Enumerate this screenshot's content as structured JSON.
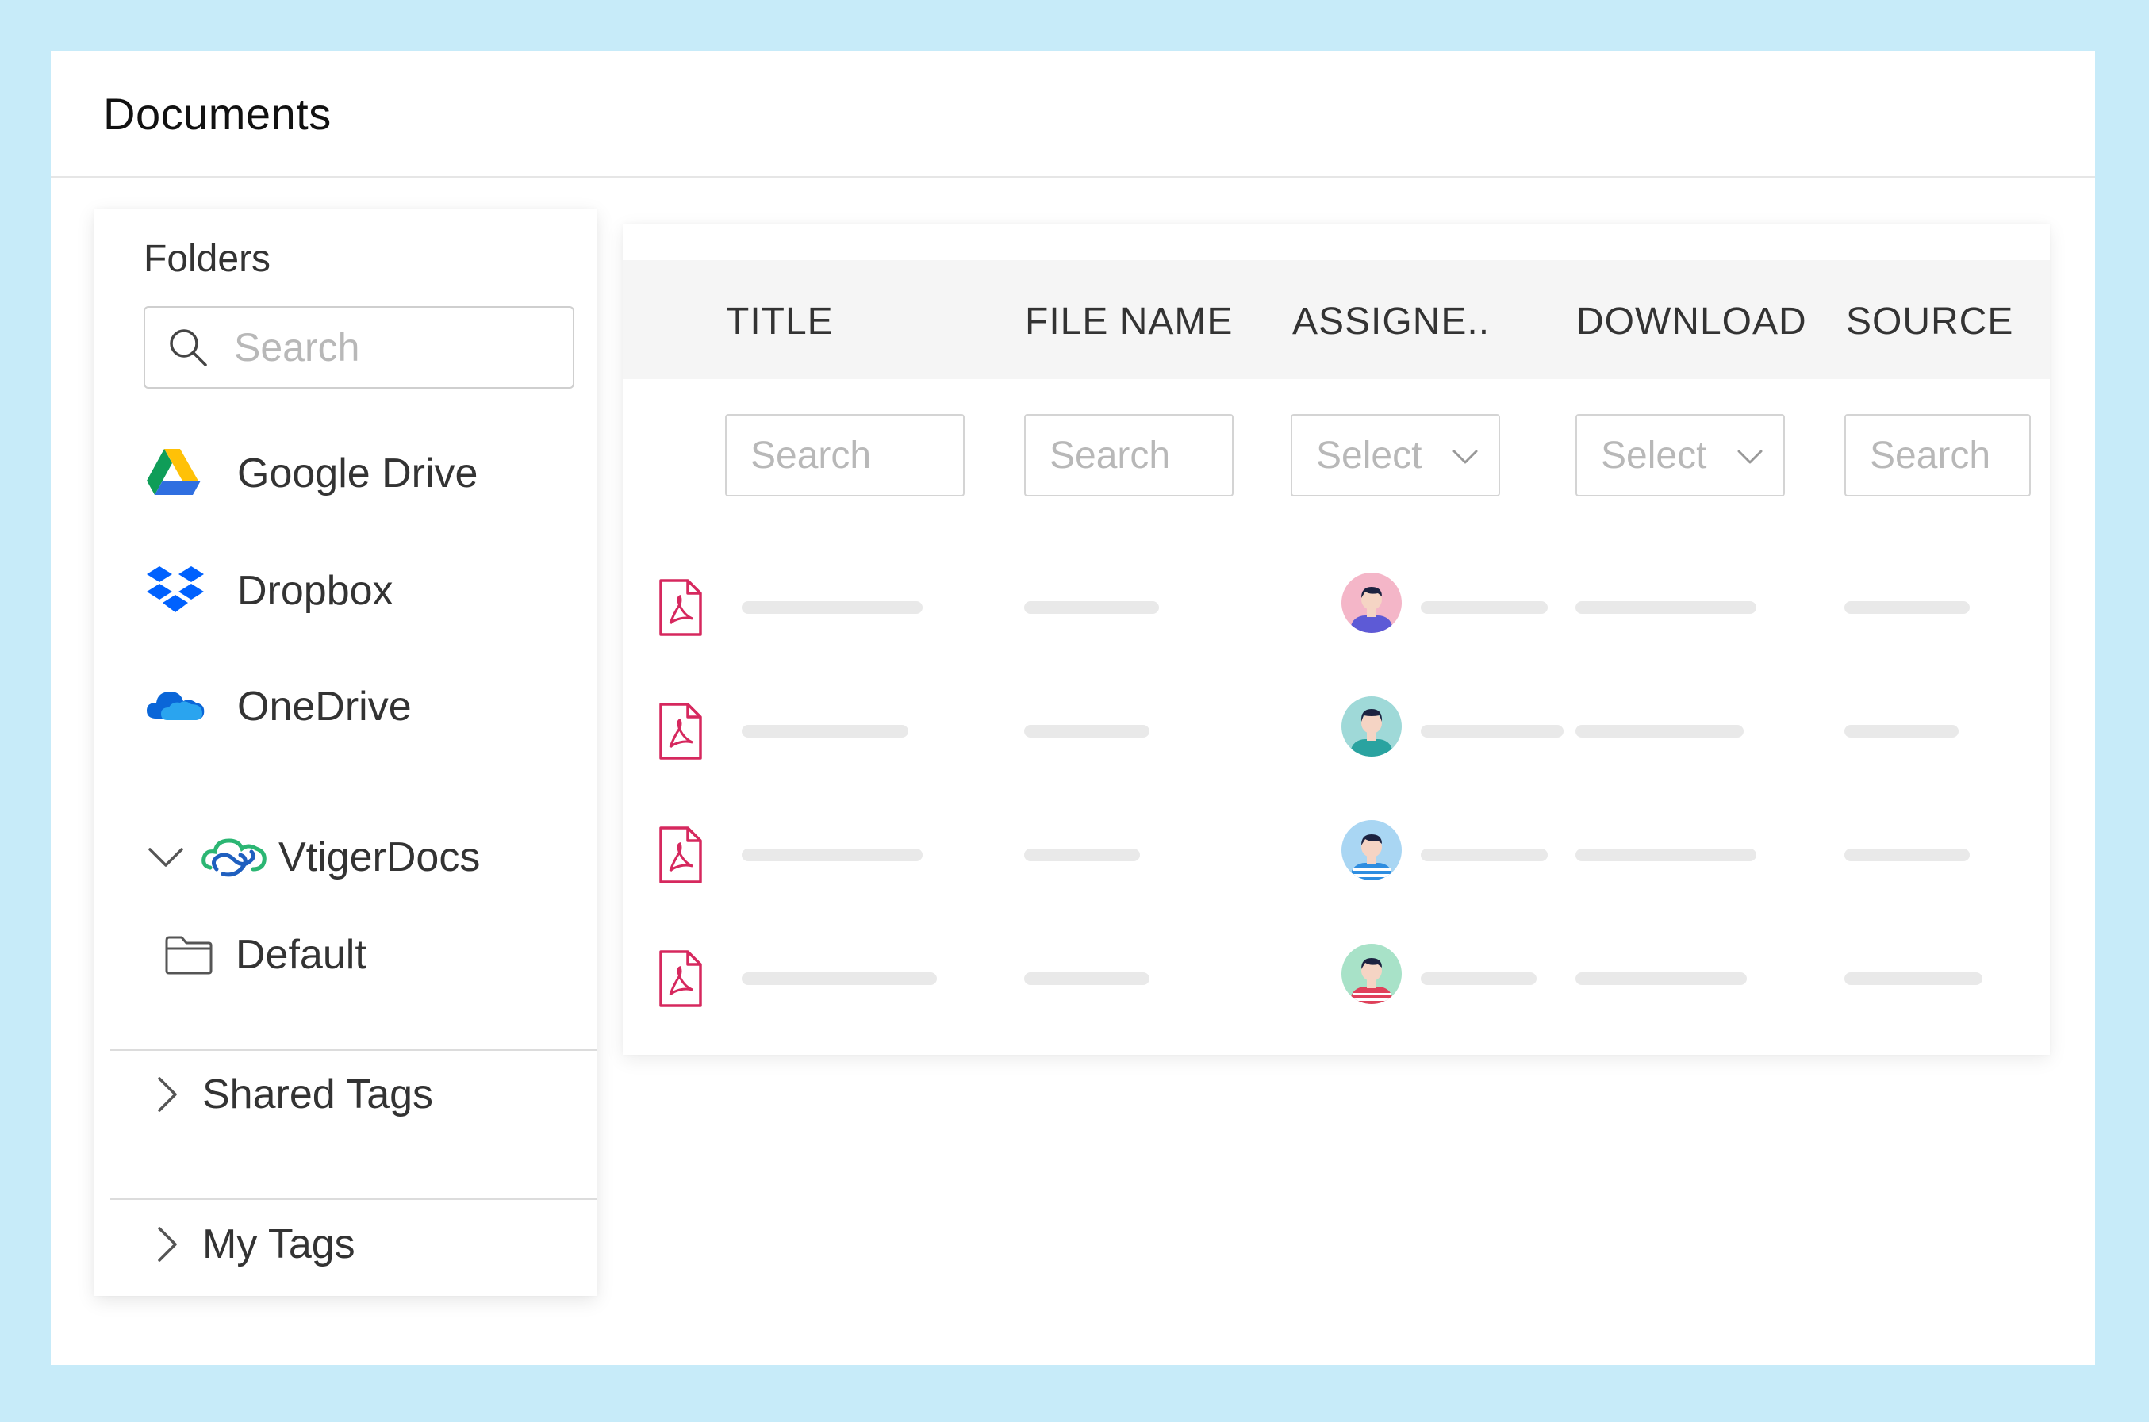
{
  "header": {
    "title": "Documents"
  },
  "sidebar": {
    "folders_label": "Folders",
    "search_placeholder": "Search",
    "providers": [
      {
        "label": "Google Drive",
        "icon": "google-drive-icon"
      },
      {
        "label": "Dropbox",
        "icon": "dropbox-icon"
      },
      {
        "label": "OneDrive",
        "icon": "onedrive-icon"
      }
    ],
    "vtiger": {
      "label": "VtigerDocs",
      "icon": "vtigerdocs-icon",
      "expanded": true
    },
    "default_folder": {
      "label": "Default",
      "icon": "folder-icon"
    },
    "shared_tags": {
      "label": "Shared Tags",
      "expanded": false
    },
    "my_tags": {
      "label": "My Tags",
      "expanded": false
    }
  },
  "table": {
    "columns": [
      {
        "key": "title",
        "label": "TITLE"
      },
      {
        "key": "file_name",
        "label": "FILE NAME"
      },
      {
        "key": "assignee",
        "label": "ASSIGNE.."
      },
      {
        "key": "download",
        "label": "DOWNLOAD"
      },
      {
        "key": "source",
        "label": "SOURCE"
      }
    ],
    "filters": {
      "title": "Search",
      "file_name": "Search",
      "assignee": "Select",
      "download": "Select",
      "source": "Search"
    },
    "rows": [
      {
        "file_icon": "pdf-icon",
        "avatar_bg": "#f4b6c8",
        "shirt": "#5d5ad6"
      },
      {
        "file_icon": "pdf-icon",
        "avatar_bg": "#9fd9d8",
        "shirt": "#2aa3a0"
      },
      {
        "file_icon": "pdf-icon",
        "avatar_bg": "#a9d6f3",
        "shirt": "#2d8de0"
      },
      {
        "file_icon": "pdf-icon",
        "avatar_bg": "#a8e2c8",
        "shirt": "#e0405a"
      }
    ]
  },
  "colors": {
    "frame": "#c7ebf9",
    "pdf": "#d6285e",
    "placeholder_bar": "#e9e9e9"
  }
}
